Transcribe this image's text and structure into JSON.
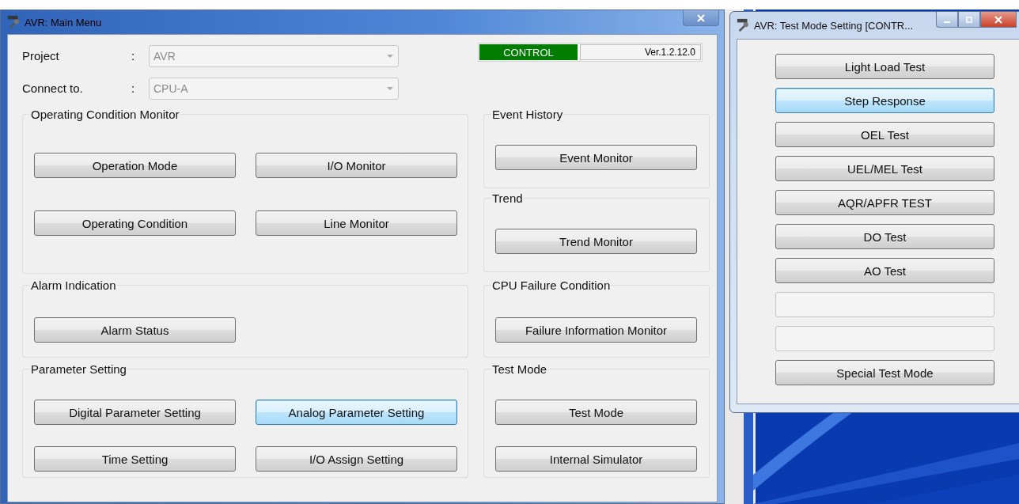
{
  "main_window": {
    "title": "AVR: Main Menu",
    "fields": [
      {
        "label": "Project",
        "separator": ":",
        "value": "AVR"
      },
      {
        "label": "Connect to.",
        "separator": ":",
        "value": "CPU-A"
      }
    ],
    "status": {
      "mode": "CONTROL",
      "version": "Ver.1.2.12.0"
    },
    "sections": [
      {
        "left": [
          {
            "title": "Operating Condition Monitor",
            "buttons": [
              {
                "label": "Operation Mode",
                "focused": false
              },
              {
                "label": "I/O Monitor",
                "focused": false
              },
              {
                "label": "Operating Condition",
                "focused": false
              },
              {
                "label": "Line Monitor",
                "focused": false
              }
            ]
          }
        ],
        "right": [
          {
            "title": "Event History",
            "buttons": [
              {
                "label": "Event Monitor",
                "focused": false
              }
            ]
          },
          {
            "title": "Trend",
            "buttons": [
              {
                "label": "Trend Monitor",
                "focused": false
              }
            ]
          }
        ]
      },
      {
        "left": [
          {
            "title": "Alarm Indication",
            "buttons": [
              {
                "label": "Alarm Status",
                "focused": false
              }
            ]
          }
        ],
        "right": [
          {
            "title": "CPU Failure Condition",
            "buttons": [
              {
                "label": "Failure Information Monitor",
                "focused": false
              }
            ]
          }
        ]
      },
      {
        "left": [
          {
            "title": "Parameter Setting",
            "buttons": [
              {
                "label": "Digital Parameter Setting",
                "focused": false
              },
              {
                "label": "Analog Parameter Setting",
                "focused": true
              },
              {
                "label": "Time Setting",
                "focused": false
              },
              {
                "label": "I/O Assign Setting",
                "focused": false
              }
            ]
          }
        ],
        "right": [
          {
            "title": "Test Mode",
            "buttons": [
              {
                "label": "Test Mode",
                "focused": false
              },
              {
                "label": "Internal Simulator",
                "focused": false
              }
            ]
          }
        ]
      }
    ]
  },
  "test_window": {
    "title": "AVR: Test Mode Setting  [CONTR...",
    "buttons": [
      {
        "kind": "button",
        "label": "Light Load Test",
        "focused": false
      },
      {
        "kind": "button",
        "label": "Step Response",
        "focused": true
      },
      {
        "kind": "button",
        "label": "OEL Test",
        "focused": false
      },
      {
        "kind": "button",
        "label": "UEL/MEL Test",
        "focused": false
      },
      {
        "kind": "button",
        "label": "AQR/APFR TEST",
        "focused": false
      },
      {
        "kind": "button",
        "label": "DO Test",
        "focused": false
      },
      {
        "kind": "button",
        "label": "AO Test",
        "focused": false
      },
      {
        "kind": "empty",
        "focused": false
      },
      {
        "kind": "empty",
        "focused": false
      },
      {
        "kind": "button",
        "label": "Special Test Mode",
        "focused": false
      }
    ]
  }
}
